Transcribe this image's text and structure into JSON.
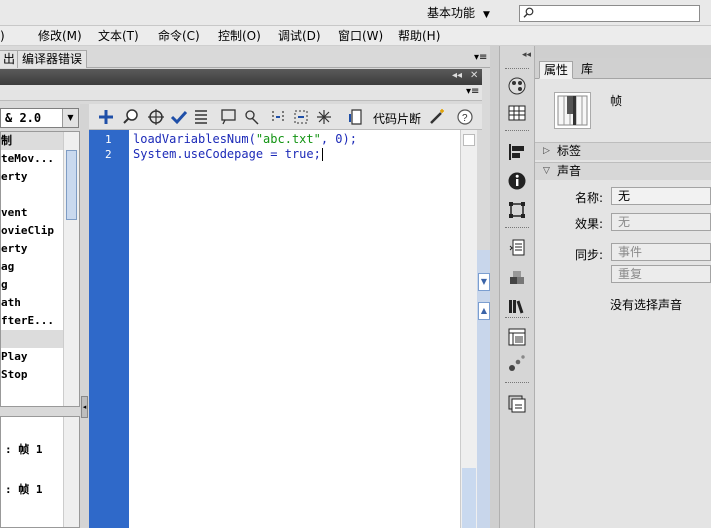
{
  "topbar": {
    "workspace_label": "基本功能",
    "search_placeholder": ""
  },
  "menubar": {
    "items": [
      "修改(M)",
      "文本(T)",
      "命令(C)",
      "控制(O)",
      "调试(D)",
      "窗口(W)",
      "帮助(H)"
    ]
  },
  "left_tabs": {
    "output_partial": "出",
    "compiler_errors": "编译器错误"
  },
  "toolbox": {
    "version": "& 2.0",
    "items": [
      {
        "label": "制",
        "category": true
      },
      {
        "label": "teMov...",
        "category": false
      },
      {
        "label": "erty",
        "category": false
      },
      {
        "label": "",
        "category": false
      },
      {
        "label": "vent",
        "category": false
      },
      {
        "label": "ovieClip",
        "category": false
      },
      {
        "label": "erty",
        "category": false
      },
      {
        "label": "ag",
        "category": false
      },
      {
        "label": "g",
        "category": false
      },
      {
        "label": "ath",
        "category": false
      },
      {
        "label": "fterE...",
        "category": false
      },
      {
        "label": "",
        "category": true
      },
      {
        "label": "Play",
        "category": false
      },
      {
        "label": "Stop",
        "category": false
      }
    ]
  },
  "script_nav": {
    "items": [
      ": 帧 1",
      ": 帧 1"
    ]
  },
  "editor_toolbar": {
    "snippet_label": "代码片断"
  },
  "editor": {
    "line_numbers": [
      "1",
      "2"
    ],
    "line1": {
      "pre": "loadVariablesNum(",
      "str": "\"abc.txt\"",
      "post": ", 0);"
    },
    "line2": {
      "text": "System.useCodepage = true;"
    }
  },
  "properties": {
    "tabs": [
      "属性",
      "库"
    ],
    "frame_label": "帧",
    "sections": {
      "label": "标签",
      "sound": "声音"
    },
    "name_label": "名称:",
    "name_value": "无",
    "effect_label": "效果:",
    "effect_value": "无",
    "sync_label": "同步:",
    "sync_value": "事件",
    "repeat_value": "重复",
    "no_sound": "没有选择声音"
  },
  "colors": {
    "gutter": "#2f69c9",
    "code_blue": "#1c2ab8",
    "string_green": "#139413"
  }
}
